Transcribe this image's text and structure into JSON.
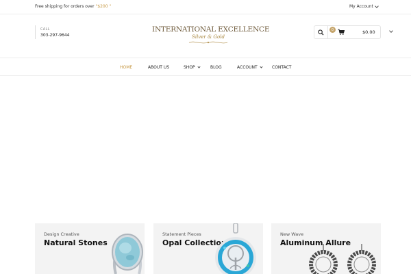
{
  "topbar": {
    "shipping_text": "Free shipping for orders over ",
    "shipping_amount": "\"$200 \"",
    "account_label": "My Account"
  },
  "header": {
    "call_label": "CALL",
    "phone": "303-297-9644",
    "logo_line1": "INTERNATIONAL EXCELLENCE",
    "logo_line2": "Silver & Gold",
    "cart_count": "0",
    "cart_total": "$0.00"
  },
  "nav": {
    "items": [
      {
        "label": "HOME"
      },
      {
        "label": "ABOUT US"
      },
      {
        "label": "SHOP"
      },
      {
        "label": "BLOG"
      },
      {
        "label": "ACCOUNT"
      },
      {
        "label": "CONTACT"
      }
    ]
  },
  "collections": [
    {
      "subtitle": "Design Creative",
      "title": "Natural Stones"
    },
    {
      "subtitle": "Statement Pieces",
      "title": "Opal Collection"
    },
    {
      "subtitle": "New Wave",
      "title": "Aluminum Allure"
    }
  ],
  "colors": {
    "accent": "#c5963f",
    "badge": "#c5a56b",
    "card_bg": "#f3f3f3"
  }
}
